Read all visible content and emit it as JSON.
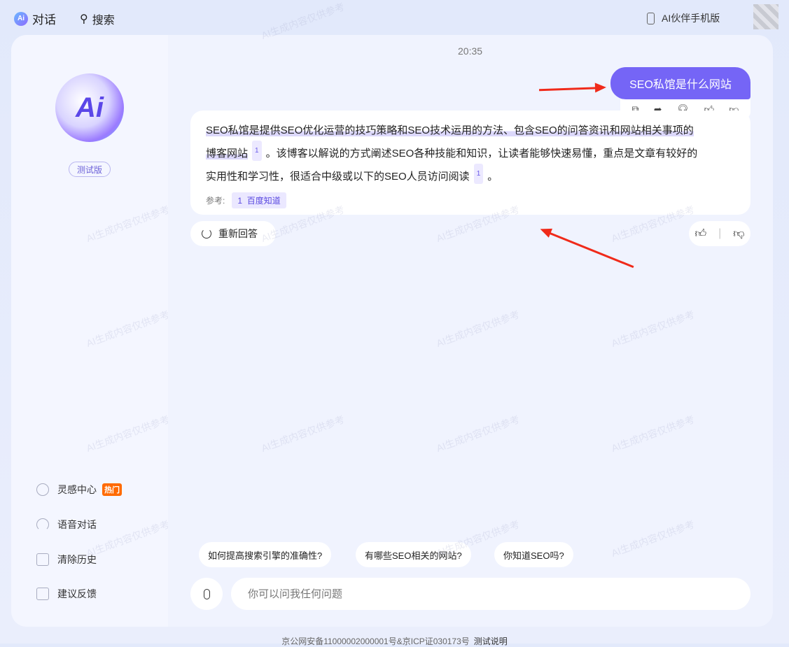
{
  "topbar": {
    "chat_label": "对话",
    "logo_text": "Ai",
    "search_label": "搜索",
    "mobile_label": "AI伙伴手机版"
  },
  "sidebar": {
    "logo_text": "Ai",
    "version_badge": "测试版",
    "items": [
      {
        "label": "灵感中心",
        "badge": "热门",
        "icon": "lightbulb-icon"
      },
      {
        "label": "语音对话",
        "icon": "headphones-icon"
      },
      {
        "label": "清除历史",
        "icon": "trash-icon"
      },
      {
        "label": "建议反馈",
        "icon": "feedback-icon"
      }
    ]
  },
  "chat": {
    "time": "20:35",
    "user_message": "SEO私馆是什么网站",
    "answer": {
      "line1": "SEO私馆是提供SEO优化运营的技巧策略和SEO技术运用的方法、包含SEO的问答资讯和网站相关事项的",
      "line2a": "博客网站",
      "cite1": "1",
      "line2b": "。该博客以解说的方式阐述SEO各种技能和知识，让读者能够快速易懂，重点是文章有较好的",
      "line3a": "实用性和学习性，很适合中级或以下的SEO人员访问阅读",
      "cite2": "1",
      "line3b": "。",
      "ref_label": "参考:",
      "ref_num": "1",
      "ref_source": "百度知道"
    },
    "regenerate_label": "重新回答"
  },
  "suggestions": [
    "如何提高搜索引擎的准确性?",
    "有哪些SEO相关的网站?",
    "你知道SEO吗?"
  ],
  "input": {
    "placeholder": "你可以问我任何问题"
  },
  "footer": {
    "license": "京公网安备11000002000001号&京ICP证030173号",
    "test_note": "测试说明"
  },
  "watermark": "AI生成内容仅供参考",
  "colors": {
    "accent": "#7565f6",
    "hot_badge": "#ff6a00",
    "annotation_arrow": "#f02a1a"
  }
}
